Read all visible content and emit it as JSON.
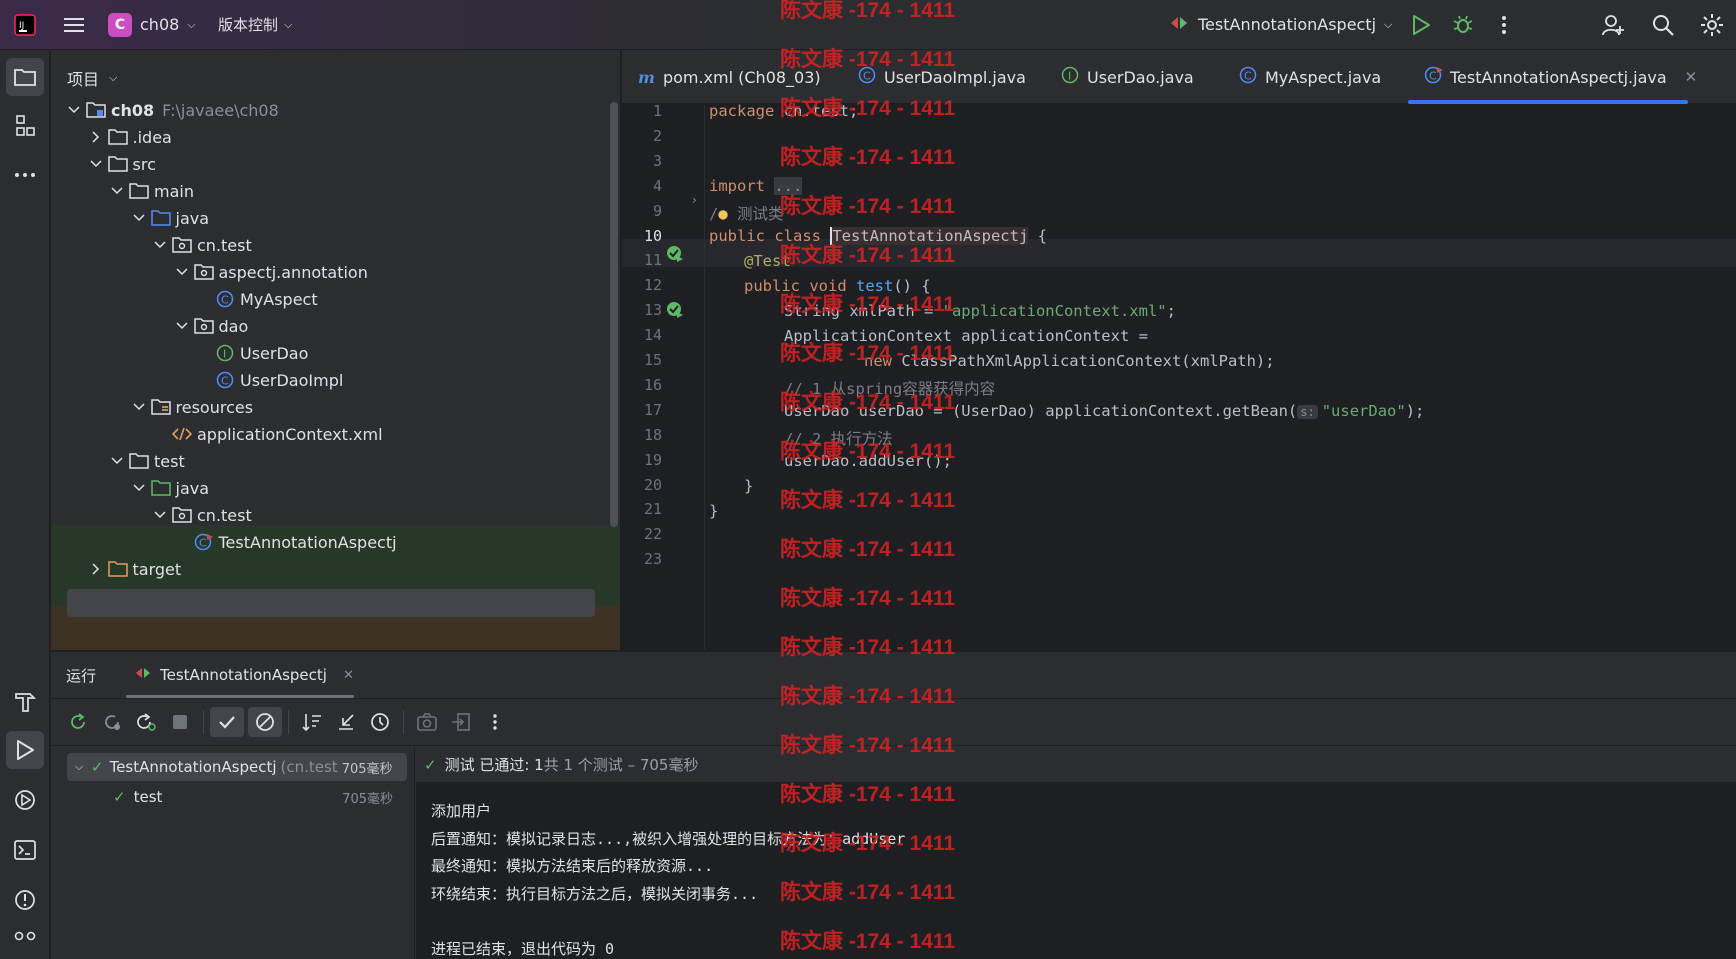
{
  "topbar": {
    "project_initial": "C",
    "project_name": "ch08",
    "vcs_label": "版本控制",
    "run_config": "TestAnnotationAspectj"
  },
  "project_panel": {
    "title": "项目",
    "tree": [
      {
        "label": "ch08",
        "hint": "F:\\javaee\\ch08",
        "icon": "module-folder-icon"
      },
      {
        "label": ".idea",
        "icon": "folder-icon"
      },
      {
        "label": "src",
        "icon": "folder-icon"
      },
      {
        "label": "main",
        "icon": "folder-icon"
      },
      {
        "label": "java",
        "icon": "source-folder-icon"
      },
      {
        "label": "cn.test",
        "icon": "package-icon"
      },
      {
        "label": "aspectj.annotation",
        "icon": "package-icon"
      },
      {
        "label": "MyAspect",
        "icon": "class-icon"
      },
      {
        "label": "dao",
        "icon": "package-icon"
      },
      {
        "label": "UserDao",
        "icon": "interface-icon"
      },
      {
        "label": "UserDaoImpl",
        "icon": "class-icon"
      },
      {
        "label": "resources",
        "icon": "resources-folder-icon"
      },
      {
        "label": "applicationContext.xml",
        "icon": "xml-icon"
      },
      {
        "label": "test",
        "icon": "folder-icon"
      },
      {
        "label": "java",
        "icon": "test-folder-icon"
      },
      {
        "label": "cn.test",
        "icon": "package-icon"
      },
      {
        "label": "TestAnnotationAspectj",
        "icon": "test-class-icon"
      },
      {
        "label": "target",
        "icon": "excluded-folder-icon"
      }
    ]
  },
  "tabs": [
    {
      "label": "pom.xml (Ch08_03)",
      "icon": "maven-icon"
    },
    {
      "label": "UserDaoImpl.java",
      "icon": "class-icon"
    },
    {
      "label": "UserDao.java",
      "icon": "interface-icon"
    },
    {
      "label": "MyAspect.java",
      "icon": "class-icon"
    },
    {
      "label": "TestAnnotationAspectj.java",
      "icon": "test-class-icon",
      "active": true
    }
  ],
  "editor": {
    "line_numbers": [
      "1",
      "2",
      "3",
      "4",
      "9",
      "10",
      "11",
      "12",
      "13",
      "14",
      "15",
      "16",
      "17",
      "18",
      "19",
      "20",
      "21",
      "22",
      "23"
    ],
    "lines": {
      "l1_kw": "package",
      "l1_rest": " cn.test;",
      "l4_kw": "import",
      "l4_fold": "...",
      "l9_cmt_a": "/",
      "l9_cmt_b": " 测试类",
      "l10_kw": "public class ",
      "l10_name": "TestAnnotationAspectj",
      "l10_rest": " {",
      "l11_ann": "@Test",
      "l12_kw": "public void ",
      "l12_fn": "test",
      "l12_rest": "() {",
      "l13_a": "String xmlPath = ",
      "l13_str": "\"applicationContext.xml\"",
      "l13_b": ";",
      "l14": "ApplicationContext applicationContext =",
      "l15_kw": "new ",
      "l15_rest": "ClassPathXmlApplicationContext(xmlPath);",
      "l16_cmt": "// 1 从spring容器获得内容",
      "l17_a": "UserDao userDao = (UserDao) applicationContext.getBean(",
      "l17_hint": "s:",
      "l17_str": "\"userDao\"",
      "l17_b": ");",
      "l18_cmt": "// 2 执行方法",
      "l19": "userDao.addUser();",
      "l20": "}",
      "l21": "}"
    }
  },
  "run_panel": {
    "title": "运行",
    "tab_label": "TestAnnotationAspectj",
    "status_prefix": "测试 已通过: 1",
    "status_suffix": "共 1 个测试 – 705毫秒",
    "tests": [
      {
        "name": "TestAnnotationAspectj",
        "hint": "(cn.test",
        "time": "705毫秒"
      },
      {
        "name": "test",
        "hint": "",
        "time": "705毫秒"
      }
    ],
    "console": [
      "添加用户",
      "后置通知：模拟记录日志...,被织入增强处理的目标方法为：addUser",
      "最终通知：模拟方法结束后的释放资源...",
      "环绕结束：执行目标方法之后，模拟关闭事务...",
      "",
      "进程已结束，退出代码为 0"
    ]
  },
  "watermark": "陈文康 -174 - 1411",
  "colors": {
    "accent": "#3574f0",
    "pass_green": "#5fb865",
    "watermark_red": "#d62222"
  }
}
